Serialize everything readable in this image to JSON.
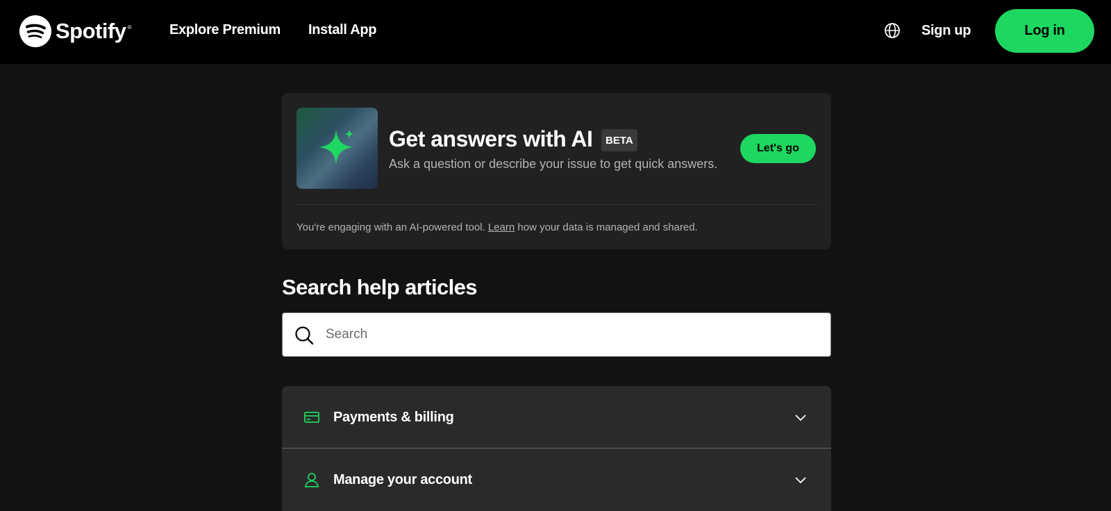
{
  "header": {
    "brand": "Spotify",
    "nav": [
      "Explore Premium",
      "Install App"
    ],
    "signup_label": "Sign up",
    "login_label": "Log in",
    "language_icon": "globe-icon"
  },
  "ai_card": {
    "title": "Get answers with AI",
    "badge": "BETA",
    "subtitle": "Ask a question or describe your issue to get quick answers.",
    "cta": "Let's go",
    "note_prefix": "You're engaging with an AI-powered tool.",
    "note_link": "Learn",
    "note_suffix": "how your data is managed and shared.",
    "thumb_icon": "sparkle-icon"
  },
  "search": {
    "heading": "Search help articles",
    "placeholder": "Search",
    "value": ""
  },
  "topics": [
    {
      "label": "Payments & billing",
      "icon": "credit-card-icon"
    },
    {
      "label": "Manage your account",
      "icon": "user-icon"
    }
  ],
  "colors": {
    "accent": "#1ed760",
    "background": "#121212",
    "topbar": "#000000",
    "card": "#212121"
  }
}
